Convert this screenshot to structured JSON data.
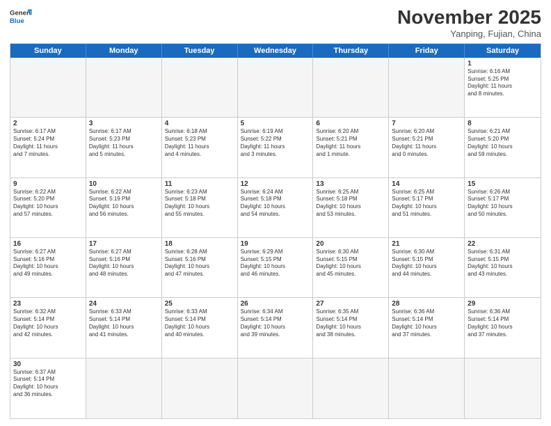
{
  "header": {
    "logo_general": "General",
    "logo_blue": "Blue",
    "month_title": "November 2025",
    "location": "Yanping, Fujian, China"
  },
  "days": [
    "Sunday",
    "Monday",
    "Tuesday",
    "Wednesday",
    "Thursday",
    "Friday",
    "Saturday"
  ],
  "rows": [
    [
      {
        "num": "",
        "text": "",
        "empty": true
      },
      {
        "num": "",
        "text": "",
        "empty": true
      },
      {
        "num": "",
        "text": "",
        "empty": true
      },
      {
        "num": "",
        "text": "",
        "empty": true
      },
      {
        "num": "",
        "text": "",
        "empty": true
      },
      {
        "num": "",
        "text": "",
        "empty": true
      },
      {
        "num": "1",
        "text": "Sunrise: 6:16 AM\nSunset: 5:25 PM\nDaylight: 11 hours\nand 8 minutes.",
        "empty": false
      }
    ],
    [
      {
        "num": "2",
        "text": "Sunrise: 6:17 AM\nSunset: 5:24 PM\nDaylight: 11 hours\nand 7 minutes.",
        "empty": false
      },
      {
        "num": "3",
        "text": "Sunrise: 6:17 AM\nSunset: 5:23 PM\nDaylight: 11 hours\nand 5 minutes.",
        "empty": false
      },
      {
        "num": "4",
        "text": "Sunrise: 6:18 AM\nSunset: 5:23 PM\nDaylight: 11 hours\nand 4 minutes.",
        "empty": false
      },
      {
        "num": "5",
        "text": "Sunrise: 6:19 AM\nSunset: 5:22 PM\nDaylight: 11 hours\nand 3 minutes.",
        "empty": false
      },
      {
        "num": "6",
        "text": "Sunrise: 6:20 AM\nSunset: 5:21 PM\nDaylight: 11 hours\nand 1 minute.",
        "empty": false
      },
      {
        "num": "7",
        "text": "Sunrise: 6:20 AM\nSunset: 5:21 PM\nDaylight: 11 hours\nand 0 minutes.",
        "empty": false
      },
      {
        "num": "8",
        "text": "Sunrise: 6:21 AM\nSunset: 5:20 PM\nDaylight: 10 hours\nand 59 minutes.",
        "empty": false
      }
    ],
    [
      {
        "num": "9",
        "text": "Sunrise: 6:22 AM\nSunset: 5:20 PM\nDaylight: 10 hours\nand 57 minutes.",
        "empty": false
      },
      {
        "num": "10",
        "text": "Sunrise: 6:22 AM\nSunset: 5:19 PM\nDaylight: 10 hours\nand 56 minutes.",
        "empty": false
      },
      {
        "num": "11",
        "text": "Sunrise: 6:23 AM\nSunset: 5:18 PM\nDaylight: 10 hours\nand 55 minutes.",
        "empty": false
      },
      {
        "num": "12",
        "text": "Sunrise: 6:24 AM\nSunset: 5:18 PM\nDaylight: 10 hours\nand 54 minutes.",
        "empty": false
      },
      {
        "num": "13",
        "text": "Sunrise: 6:25 AM\nSunset: 5:18 PM\nDaylight: 10 hours\nand 53 minutes.",
        "empty": false
      },
      {
        "num": "14",
        "text": "Sunrise: 6:25 AM\nSunset: 5:17 PM\nDaylight: 10 hours\nand 51 minutes.",
        "empty": false
      },
      {
        "num": "15",
        "text": "Sunrise: 6:26 AM\nSunset: 5:17 PM\nDaylight: 10 hours\nand 50 minutes.",
        "empty": false
      }
    ],
    [
      {
        "num": "16",
        "text": "Sunrise: 6:27 AM\nSunset: 5:16 PM\nDaylight: 10 hours\nand 49 minutes.",
        "empty": false
      },
      {
        "num": "17",
        "text": "Sunrise: 6:27 AM\nSunset: 5:16 PM\nDaylight: 10 hours\nand 48 minutes.",
        "empty": false
      },
      {
        "num": "18",
        "text": "Sunrise: 6:28 AM\nSunset: 5:16 PM\nDaylight: 10 hours\nand 47 minutes.",
        "empty": false
      },
      {
        "num": "19",
        "text": "Sunrise: 6:29 AM\nSunset: 5:15 PM\nDaylight: 10 hours\nand 46 minutes.",
        "empty": false
      },
      {
        "num": "20",
        "text": "Sunrise: 6:30 AM\nSunset: 5:15 PM\nDaylight: 10 hours\nand 45 minutes.",
        "empty": false
      },
      {
        "num": "21",
        "text": "Sunrise: 6:30 AM\nSunset: 5:15 PM\nDaylight: 10 hours\nand 44 minutes.",
        "empty": false
      },
      {
        "num": "22",
        "text": "Sunrise: 6:31 AM\nSunset: 5:15 PM\nDaylight: 10 hours\nand 43 minutes.",
        "empty": false
      }
    ],
    [
      {
        "num": "23",
        "text": "Sunrise: 6:32 AM\nSunset: 5:14 PM\nDaylight: 10 hours\nand 42 minutes.",
        "empty": false
      },
      {
        "num": "24",
        "text": "Sunrise: 6:33 AM\nSunset: 5:14 PM\nDaylight: 10 hours\nand 41 minutes.",
        "empty": false
      },
      {
        "num": "25",
        "text": "Sunrise: 6:33 AM\nSunset: 5:14 PM\nDaylight: 10 hours\nand 40 minutes.",
        "empty": false
      },
      {
        "num": "26",
        "text": "Sunrise: 6:34 AM\nSunset: 5:14 PM\nDaylight: 10 hours\nand 39 minutes.",
        "empty": false
      },
      {
        "num": "27",
        "text": "Sunrise: 6:35 AM\nSunset: 5:14 PM\nDaylight: 10 hours\nand 38 minutes.",
        "empty": false
      },
      {
        "num": "28",
        "text": "Sunrise: 6:36 AM\nSunset: 5:14 PM\nDaylight: 10 hours\nand 37 minutes.",
        "empty": false
      },
      {
        "num": "29",
        "text": "Sunrise: 6:36 AM\nSunset: 5:14 PM\nDaylight: 10 hours\nand 37 minutes.",
        "empty": false
      }
    ],
    [
      {
        "num": "30",
        "text": "Sunrise: 6:37 AM\nSunset: 5:14 PM\nDaylight: 10 hours\nand 36 minutes.",
        "empty": false
      },
      {
        "num": "",
        "text": "",
        "empty": true
      },
      {
        "num": "",
        "text": "",
        "empty": true
      },
      {
        "num": "",
        "text": "",
        "empty": true
      },
      {
        "num": "",
        "text": "",
        "empty": true
      },
      {
        "num": "",
        "text": "",
        "empty": true
      },
      {
        "num": "",
        "text": "",
        "empty": true
      }
    ]
  ]
}
